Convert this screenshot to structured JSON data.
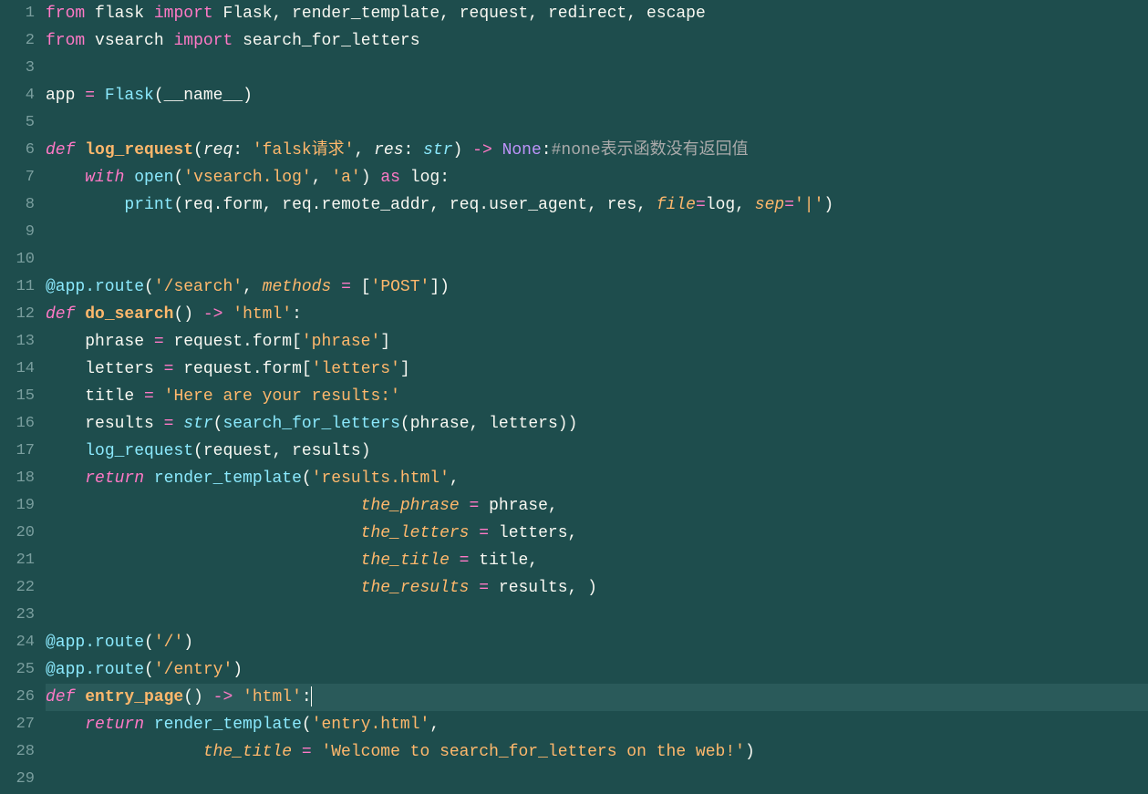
{
  "gutter": {
    "lines": [
      "1",
      "2",
      "3",
      "4",
      "5",
      "6",
      "7",
      "8",
      "9",
      "10",
      "11",
      "12",
      "13",
      "14",
      "15",
      "16",
      "17",
      "18",
      "19",
      "20",
      "21",
      "22",
      "23",
      "24",
      "25",
      "26",
      "27",
      "28",
      "29"
    ]
  },
  "highlighted_line": 26,
  "code": {
    "line1": {
      "from": "from",
      "module1": "flask",
      "import": "import",
      "names": "Flask, render_template, request, redirect, escape"
    },
    "line2": {
      "from": "from",
      "module": "vsearch",
      "import": "import",
      "name": "search_for_letters"
    },
    "line4": {
      "var": "app",
      "eq": " = ",
      "call": "Flask",
      "paren_open": "(",
      "arg": "__name__",
      "paren_close": ")"
    },
    "line6": {
      "def": "def",
      "name": "log_request",
      "open": "(",
      "param1": "req",
      "colon1": ": ",
      "type1": "'falsk请求'",
      "comma": ", ",
      "param2": "res",
      "colon2": ": ",
      "type2": "str",
      "close": ")",
      "arrow": " -> ",
      "ret": "None",
      "colon_end": ":",
      "comment": "#none表示函数没有返回值"
    },
    "line7": {
      "indent": "    ",
      "with": "with",
      "sp1": " ",
      "open_call": "open",
      "paren_open": "(",
      "arg1": "'vsearch.log'",
      "comma": ", ",
      "arg2": "'a'",
      "paren_close": ")",
      "sp2": " ",
      "as": "as",
      "sp3": " ",
      "var": "log",
      "colon": ":"
    },
    "line8": {
      "indent": "        ",
      "print": "print",
      "paren_open": "(",
      "args": "req.form, req.remote_addr, req.user_agent, res, ",
      "kwarg1": "file",
      "eq1": "=",
      "val1": "log",
      "comma": ", ",
      "kwarg2": "sep",
      "eq2": "=",
      "val2": "'|'",
      "paren_close": ")"
    },
    "line11": {
      "decorator": "@app.route",
      "open": "(",
      "arg1": "'/search'",
      "comma": ", ",
      "kwarg": "methods",
      "eq": " = ",
      "list": "[",
      "val": "'POST'",
      "list_close": "]",
      "close": ")"
    },
    "line12": {
      "def": "def",
      "sp": " ",
      "name": "do_search",
      "parens": "()",
      "arrow": " -> ",
      "ret": "'html'",
      "colon": ":"
    },
    "line13": {
      "indent": "    ",
      "var": "phrase",
      "eq": " = ",
      "expr": "request.form[",
      "key": "'phrase'",
      "close": "]"
    },
    "line14": {
      "indent": "    ",
      "var": "letters",
      "eq": " = ",
      "expr": "request.form[",
      "key": "'letters'",
      "close": "]"
    },
    "line15": {
      "indent": "    ",
      "var": "title",
      "eq": " = ",
      "val": "'Here are your results:'"
    },
    "line16": {
      "indent": "    ",
      "var": "results",
      "eq": " = ",
      "str": "str",
      "open": "(",
      "call": "search_for_letters",
      "open2": "(",
      "args": "phrase, letters",
      "close2": ")",
      "close": ")"
    },
    "line17": {
      "indent": "    ",
      "call": "log_request",
      "open": "(",
      "args": "request, results",
      "close": ")"
    },
    "line18": {
      "indent": "    ",
      "return": "return",
      "sp": " ",
      "call": "render_template",
      "open": "(",
      "arg": "'results.html'",
      "comma": ","
    },
    "line19": {
      "indent": "                                ",
      "kwarg": "the_phrase",
      "eq": " = ",
      "val": "phrase",
      "comma": ","
    },
    "line20": {
      "indent": "                                ",
      "kwarg": "the_letters",
      "eq": " = ",
      "val": "letters",
      "comma": ","
    },
    "line21": {
      "indent": "                                ",
      "kwarg": "the_title",
      "eq": " = ",
      "val": "title",
      "comma": ","
    },
    "line22": {
      "indent": "                                ",
      "kwarg": "the_results",
      "eq": " = ",
      "val": "results",
      "comma": ", )"
    },
    "line24": {
      "decorator": "@app.route",
      "open": "(",
      "arg": "'/'",
      "close": ")"
    },
    "line25": {
      "decorator": "@app.route",
      "open": "(",
      "arg": "'/entry'",
      "close": ")"
    },
    "line26": {
      "def": "def",
      "sp": " ",
      "name": "entry_page",
      "parens": "()",
      "arrow": " -> ",
      "ret": "'html'",
      "colon": ":"
    },
    "line27": {
      "indent": "    ",
      "return": "return",
      "sp": " ",
      "call": "render_template",
      "open": "(",
      "arg": "'entry.html'",
      "comma": ","
    },
    "line28": {
      "indent": "                ",
      "kwarg": "the_title",
      "eq": " = ",
      "val": "'Welcome to search_for_letters on the web!'",
      "close": ")"
    }
  }
}
